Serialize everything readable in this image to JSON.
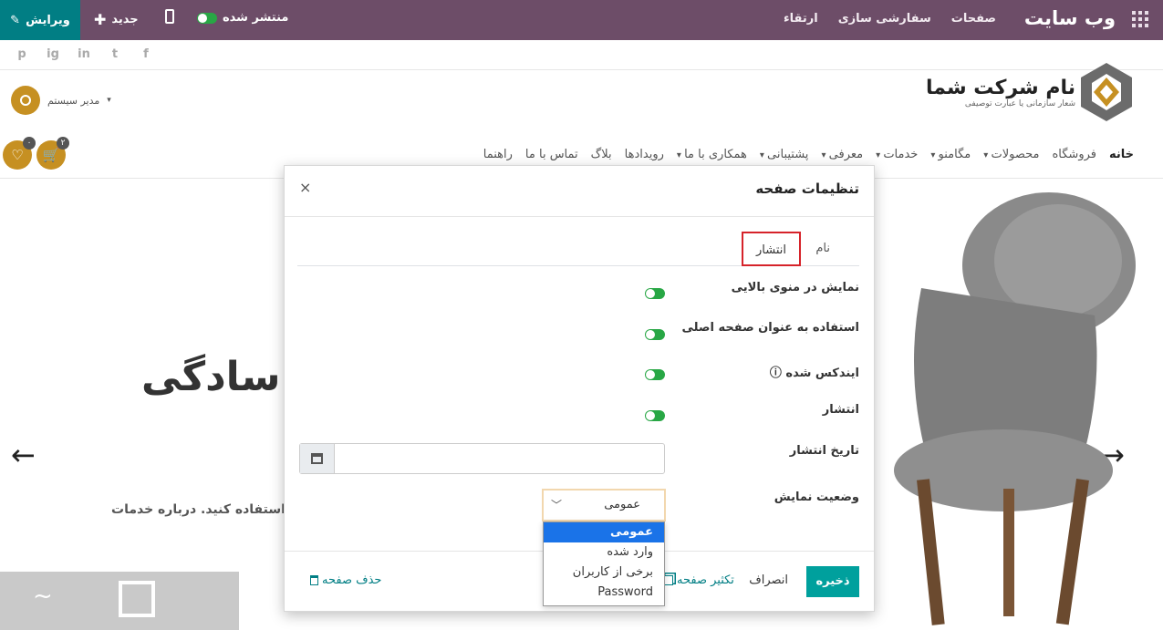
{
  "topbar": {
    "brand": "وب سایت",
    "menu": [
      "صفحات",
      "سفارشی سازی",
      "ارتقاء"
    ],
    "publish_label": "منتشر شده",
    "new_label": "جدید",
    "edit_label": "ویرایش"
  },
  "header": {
    "social": [
      "f",
      "t",
      "in",
      "ig",
      "p"
    ],
    "company_name": "نام شرکت شما",
    "company_slogan": "شعار سازمانی یا عبارت توصیفی",
    "user_name": "مدیر سیستم",
    "nav": [
      {
        "label": "خانه",
        "active": true,
        "dropdown": false
      },
      {
        "label": "فروشگاه",
        "dropdown": false
      },
      {
        "label": "محصولات",
        "dropdown": true
      },
      {
        "label": "مگامنو",
        "dropdown": true
      },
      {
        "label": "خدمات",
        "dropdown": true
      },
      {
        "label": "معرفی",
        "dropdown": true
      },
      {
        "label": "پشتیبانی",
        "dropdown": true
      },
      {
        "label": "همکاری با ما",
        "dropdown": true
      },
      {
        "label": "رویدادها",
        "dropdown": false
      },
      {
        "label": "بلاگ",
        "dropdown": false
      },
      {
        "label": "تماس با ما",
        "dropdown": false
      },
      {
        "label": "راهنما",
        "dropdown": false
      }
    ],
    "cart_count": "۲",
    "wishlist_count": "۰"
  },
  "hero": {
    "title": "سادگی...",
    "subtitle": "ود استفاده کنید. درباره خدمات",
    "prev_arrow": "←",
    "next_arrow": "→"
  },
  "modal": {
    "title": "تنظیمات صفحه",
    "close": "×",
    "tabs": {
      "name": "نام",
      "publish": "انتشار"
    },
    "fields": {
      "show_in_menu": "نمایش در منوی بالایی",
      "use_as_home": "استفاده به عنوان صفحه اصلی",
      "indexed": "ایندکس شده ⓘ",
      "publish": "انتشار",
      "publish_date": "تاریخ انتشار",
      "visibility": "وضعیت نمایش"
    },
    "visibility_selected": "عمومی",
    "visibility_options": [
      "عمومی",
      "وارد شده",
      "برخی از کاربران",
      "Password"
    ],
    "footer": {
      "save": "ذخیره",
      "cancel": "انصراف",
      "duplicate": "تکثیر صفحه",
      "delete": "حذف صفحه"
    }
  },
  "colors": {
    "topbar": "#6d4d68",
    "edit_bg": "#017e84",
    "accent": "#c69022",
    "toggle_on": "#28a745",
    "save_btn": "#00a09d",
    "tab_highlight": "#d6232a"
  }
}
